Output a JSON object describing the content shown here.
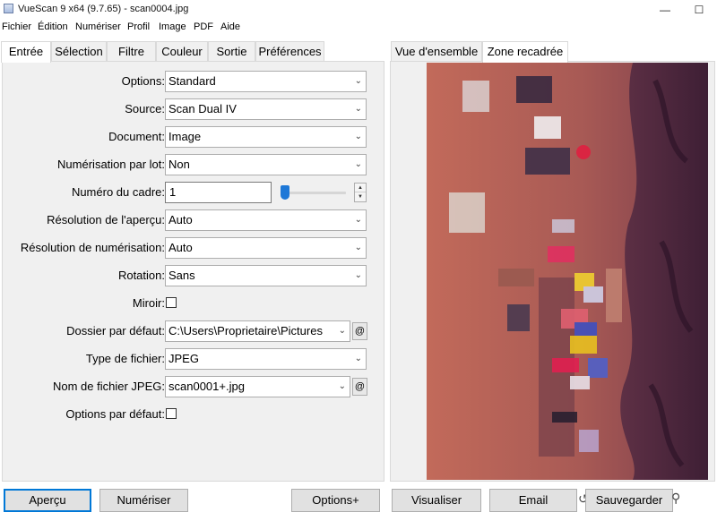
{
  "window": {
    "title": "VueScan 9 x64 (9.7.65) - scan0004.jpg",
    "minimize_glyph": "—",
    "maximize_glyph": "☐"
  },
  "menu": [
    "Fichier",
    "Édition",
    "Numériser",
    "Profil",
    "Image",
    "PDF",
    "Aide"
  ],
  "left_tabs": [
    "Entrée",
    "Sélection",
    "Filtre",
    "Couleur",
    "Sortie",
    "Préférences"
  ],
  "right_tabs": [
    "Vue d'ensemble",
    "Zone recadrée"
  ],
  "form": {
    "options": {
      "label": "Options:",
      "value": "Standard"
    },
    "source": {
      "label": "Source:",
      "value": "Scan Dual IV"
    },
    "document": {
      "label": "Document:",
      "value": "Image"
    },
    "batch": {
      "label": "Numérisation par lot:",
      "value": "Non"
    },
    "frame": {
      "label": "Numéro du cadre:",
      "value": "1"
    },
    "preview_res": {
      "label": "Résolution de l'aperçu:",
      "value": "Auto"
    },
    "scan_res": {
      "label": "Résolution de numérisation:",
      "value": "Auto"
    },
    "rotation": {
      "label": "Rotation:",
      "value": "Sans"
    },
    "mirror": {
      "label": "Miroir:"
    },
    "default_folder": {
      "label": "Dossier par défaut:",
      "value": "C:\\Users\\Proprietaire\\Pictures",
      "button": "@"
    },
    "file_type": {
      "label": "Type de fichier:",
      "value": "JPEG"
    },
    "jpeg_name": {
      "label": "Nom de fichier JPEG:",
      "value": "scan0001+.jpg",
      "button": "@"
    },
    "default_options": {
      "label": "Options par défaut:"
    }
  },
  "buttons": {
    "preview": "Aperçu",
    "scan": "Numériser",
    "options_plus": "Options+",
    "view": "Visualiser",
    "email": "Email",
    "save": "Sauvegarder"
  },
  "colors": {
    "accent": "#0078d7",
    "photo_tint": "#a8544c"
  }
}
